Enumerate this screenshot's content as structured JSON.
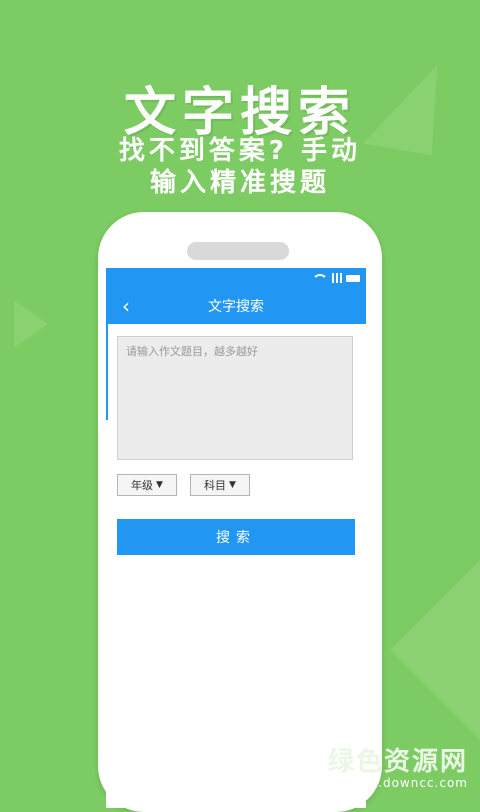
{
  "promo": {
    "headline": "文字搜索",
    "subline1": "找不到答案? 手动",
    "subline2": "输入精准搜题"
  },
  "app": {
    "nav_title": "文字搜索",
    "back_label": "‹",
    "textarea_placeholder": "请输入作文题目，越多越好",
    "grade_label": "年级",
    "subject_label": "科目",
    "caret": "▼",
    "search_label": "搜索"
  },
  "watermark": {
    "main": "绿色资源网",
    "url": "www.downcc.com"
  },
  "colors": {
    "background": "#7ccb63",
    "accent": "#2196f3"
  }
}
